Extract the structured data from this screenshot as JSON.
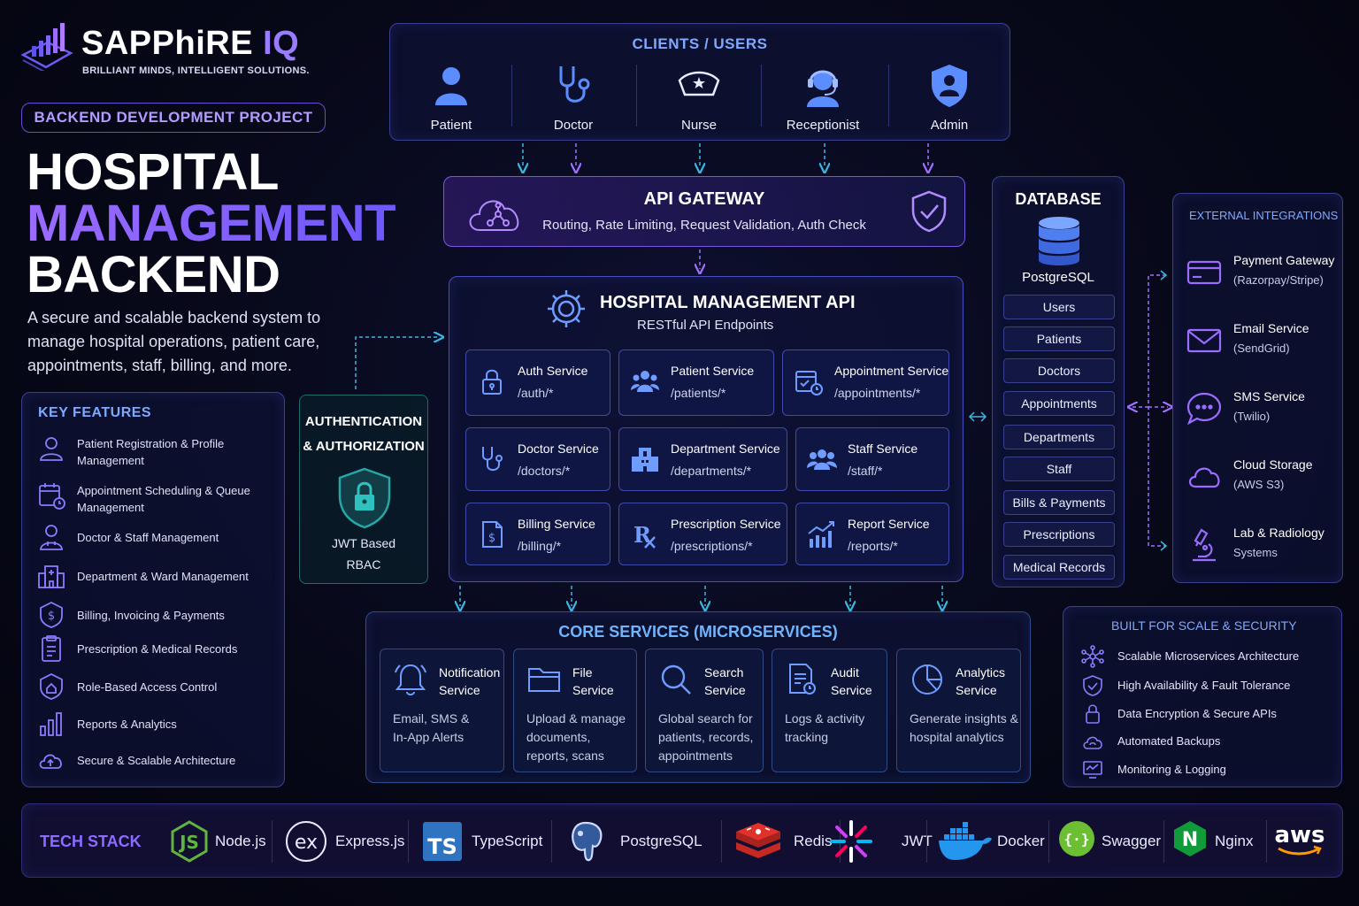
{
  "brand": {
    "name_main": "SAPPhiRE",
    "name_accent": "IQ",
    "tagline": "BRILLIANT MINDS, INTELLIGENT SOLUTIONS."
  },
  "project_badge": "BACKEND DEVELOPMENT PROJECT",
  "hero": {
    "line1": "HOSPITAL",
    "line2": "MANAGEMENT",
    "line3": "BACKEND",
    "description": "A secure and scalable backend system to manage hospital operations, patient care, appointments, staff, billing, and more."
  },
  "key_features": {
    "title": "KEY FEATURES",
    "items": [
      {
        "label": "Patient Registration & Profile Management",
        "icon": "user-icon"
      },
      {
        "label": "Appointment Scheduling & Queue Management",
        "icon": "calendar-clock-icon"
      },
      {
        "label": "Doctor & Staff Management",
        "icon": "doctor-icon"
      },
      {
        "label": "Department & Ward Management",
        "icon": "hospital-icon"
      },
      {
        "label": "Billing, Invoicing & Payments",
        "icon": "dollar-icon"
      },
      {
        "label": "Prescription & Medical Records",
        "icon": "clipboard-icon"
      },
      {
        "label": "Role-Based Access Control",
        "icon": "shield-home-icon"
      },
      {
        "label": "Reports & Analytics",
        "icon": "bar-chart-icon"
      },
      {
        "label": "Secure & Scalable Architecture",
        "icon": "cloud-upload-icon"
      }
    ]
  },
  "clients": {
    "title": "CLIENTS / USERS",
    "items": [
      {
        "label": "Patient",
        "icon": "patient-icon"
      },
      {
        "label": "Doctor",
        "icon": "stethoscope-icon"
      },
      {
        "label": "Nurse",
        "icon": "nurse-cap-icon"
      },
      {
        "label": "Receptionist",
        "icon": "headset-icon"
      },
      {
        "label": "Admin",
        "icon": "admin-shield-icon"
      }
    ]
  },
  "api_gateway": {
    "title": "API GATEWAY",
    "subtitle": "Routing, Rate Limiting, Request Validation, Auth Check"
  },
  "hm_api": {
    "title": "HOSPITAL MANAGEMENT API",
    "subtitle": "RESTful API Endpoints",
    "services": [
      {
        "name": "Auth Service",
        "endpoint": "/auth/*",
        "icon": "lock-icon"
      },
      {
        "name": "Patient Service",
        "endpoint": "/patients/*",
        "icon": "patients-group-icon"
      },
      {
        "name": "Appointment Service",
        "endpoint": "/appointments/*",
        "icon": "calendar-icon"
      },
      {
        "name": "Doctor Service",
        "endpoint": "/doctors/*",
        "icon": "stethoscope-icon"
      },
      {
        "name": "Department Service",
        "endpoint": "/departments/*",
        "icon": "building-icon"
      },
      {
        "name": "Staff Service",
        "endpoint": "/staff/*",
        "icon": "staff-group-icon"
      },
      {
        "name": "Billing Service",
        "endpoint": "/billing/*",
        "icon": "bill-icon"
      },
      {
        "name": "Prescription Service",
        "endpoint": "/prescriptions/*",
        "icon": "rx-icon"
      },
      {
        "name": "Report Service",
        "endpoint": "/reports/*",
        "icon": "report-chart-icon"
      }
    ]
  },
  "auth_box": {
    "title_line1": "AUTHENTICATION",
    "title_line2": "& AUTHORIZATION",
    "sub_line1": "JWT Based",
    "sub_line2": "RBAC"
  },
  "database": {
    "title": "DATABASE",
    "engine": "PostgreSQL",
    "tables": [
      "Users",
      "Patients",
      "Doctors",
      "Appointments",
      "Departments",
      "Staff",
      "Bills & Payments",
      "Prescriptions",
      "Medical Records"
    ]
  },
  "external": {
    "title": "EXTERNAL INTEGRATIONS",
    "items": [
      {
        "name": "Payment Gateway",
        "sub": "(Razorpay/Stripe)",
        "icon": "credit-card-icon"
      },
      {
        "name": "Email Service",
        "sub": "(SendGrid)",
        "icon": "envelope-icon"
      },
      {
        "name": "SMS Service",
        "sub": "(Twilio)",
        "icon": "chat-bubble-icon"
      },
      {
        "name": "Cloud Storage",
        "sub": "(AWS S3)",
        "icon": "cloud-icon"
      },
      {
        "name": "Lab & Radiology",
        "sub": "Systems",
        "icon": "microscope-icon"
      }
    ]
  },
  "core_services": {
    "title": "CORE SERVICES (MICROSERVICES)",
    "items": [
      {
        "name1": "Notification",
        "name2": "Service",
        "desc": "Email, SMS & In-App Alerts",
        "icon": "bell-icon"
      },
      {
        "name1": "File",
        "name2": "Service",
        "desc": "Upload & manage documents, reports, scans",
        "icon": "folder-icon"
      },
      {
        "name1": "Search",
        "name2": "Service",
        "desc": "Global search for patients, records, appointments",
        "icon": "search-icon"
      },
      {
        "name1": "Audit",
        "name2": "Service",
        "desc": "Logs & activity tracking",
        "icon": "audit-doc-icon"
      },
      {
        "name1": "Analytics",
        "name2": "Service",
        "desc": "Generate insights & hospital analytics",
        "icon": "pie-chart-icon"
      }
    ]
  },
  "scale_security": {
    "title": "BUILT FOR SCALE & SECURITY",
    "items": [
      {
        "label": "Scalable Microservices Architecture",
        "icon": "network-icon"
      },
      {
        "label": "High Availability & Fault Tolerance",
        "icon": "shield-check-icon"
      },
      {
        "label": "Data Encryption & Secure APIs",
        "icon": "lock-icon"
      },
      {
        "label": "Automated Backups",
        "icon": "cloud-refresh-icon"
      },
      {
        "label": "Monitoring & Logging",
        "icon": "monitor-icon"
      }
    ]
  },
  "tech_stack": {
    "title": "TECH STACK",
    "items": [
      {
        "label": "Node.js",
        "icon": "nodejs-logo-icon"
      },
      {
        "label": "Express.js",
        "icon": "express-logo-icon"
      },
      {
        "label": "TypeScript",
        "icon": "typescript-logo-icon",
        "logo_text": "TS"
      },
      {
        "label": "PostgreSQL",
        "icon": "postgresql-logo-icon"
      },
      {
        "label": "Redis",
        "icon": "redis-logo-icon"
      },
      {
        "label": "JWT",
        "icon": "jwt-logo-icon"
      },
      {
        "label": "Docker",
        "icon": "docker-logo-icon"
      },
      {
        "label": "Swagger",
        "icon": "swagger-logo-icon"
      },
      {
        "label": "Nginx",
        "icon": "nginx-logo-icon",
        "logo_text": "N"
      },
      {
        "label": "",
        "icon": "aws-logo-icon",
        "logo_text": "aws"
      }
    ]
  },
  "colors": {
    "accent_purple": "#8a5cff",
    "accent_blue": "#7fa8ff",
    "connector_cyan": "#3ab7e0",
    "connector_purple": "#a070ff"
  }
}
